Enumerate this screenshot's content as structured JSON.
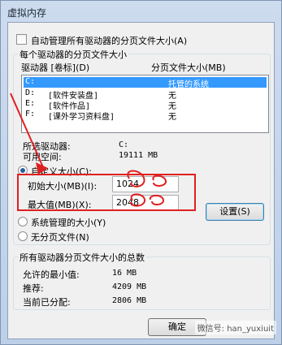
{
  "window": {
    "title": "虚拟内存"
  },
  "auto_manage": {
    "label": "自动管理所有驱动器的分页文件大小(A)",
    "checked": false
  },
  "drives_group": {
    "title": "每个驱动器的分页文件大小",
    "col_drive": "驱动器 [卷标](D)",
    "col_size": "分页文件大小(MB)",
    "rows": [
      {
        "drive": "C:",
        "label": "",
        "size": "托管的系统",
        "selected": true
      },
      {
        "drive": "D:",
        "label": "[软件安装盘]",
        "size": "无",
        "selected": false
      },
      {
        "drive": "E:",
        "label": "[软件作品]",
        "size": "无",
        "selected": false
      },
      {
        "drive": "F:",
        "label": "[课外学习资料盘]",
        "size": "无",
        "selected": false
      }
    ],
    "selected_drive_label": "所选驱动器:",
    "selected_drive_value": "C:",
    "available_label": "可用空间:",
    "available_value": "19111 MB",
    "custom_label": "自定义大小(C):",
    "initial_label": "初始大小(MB)(I):",
    "initial_value": "1024",
    "max_label": "最大值(MB)(X):",
    "max_value": "2048",
    "system_label": "系统管理的大小(Y)",
    "none_label": "无分页文件(N)",
    "set_button": "设置(S)"
  },
  "totals_group": {
    "title": "所有驱动器分页文件大小的总数",
    "min_label": "允许的最小值:",
    "min_value": "16 MB",
    "rec_label": "推荐:",
    "rec_value": "4209 MB",
    "cur_label": "当前已分配:",
    "cur_value": "2806 MB"
  },
  "footer": {
    "ok_button": "确定",
    "watermark": "微信号: han_yuxiuit"
  },
  "colors": {
    "annotation": "#e02020",
    "selection": "#3399ff"
  }
}
